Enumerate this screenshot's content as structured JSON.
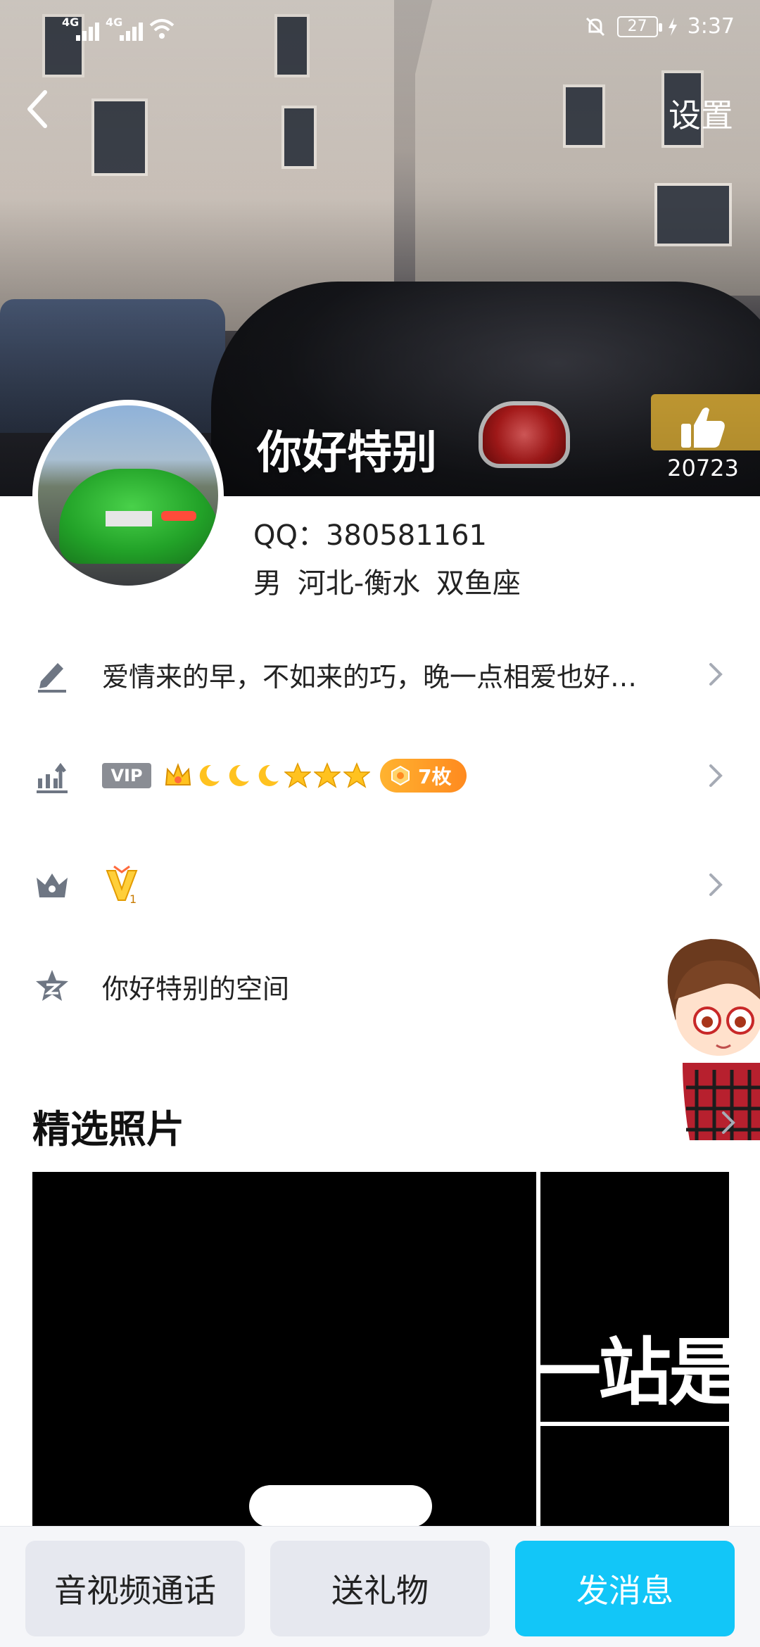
{
  "status_bar": {
    "sim1": "4G",
    "sim2": "4G",
    "battery": "27",
    "time": "3:37"
  },
  "header": {
    "back_icon": "chevron-left-icon",
    "settings_label": "设置",
    "nickname": "你好特别",
    "like_icon": "thumbs-up-icon",
    "like_count": "20723"
  },
  "profile": {
    "qq": "QQ：380581161",
    "gender": "男",
    "location": "河北-衡水",
    "zodiac": "双鱼座"
  },
  "rows": {
    "signature": {
      "icon": "edit-pen-icon",
      "text": "爱情来的早，不如来的巧，晚一点相爱也好…"
    },
    "vip": {
      "icon": "growth-chart-icon",
      "tag": "VIP",
      "badge_icons": [
        "crown-icon",
        "moon-icon",
        "moon-icon",
        "moon-icon",
        "star-icon",
        "star-icon",
        "star-icon"
      ],
      "medal_count": "7枚"
    },
    "honor": {
      "icon": "crown-icon",
      "badge_text": "1"
    },
    "qzone": {
      "icon": "qzone-star-icon",
      "text": "你好特别的空间"
    }
  },
  "photos": {
    "title": "精选照片",
    "photo2_text": "一站是"
  },
  "bottom_bar": {
    "call_label": "音视频通话",
    "gift_label": "送礼物",
    "message_label": "发消息"
  },
  "colors": {
    "accent": "#12C6F8",
    "medal": "#FF9A26",
    "icon_gray": "#6E7683"
  }
}
